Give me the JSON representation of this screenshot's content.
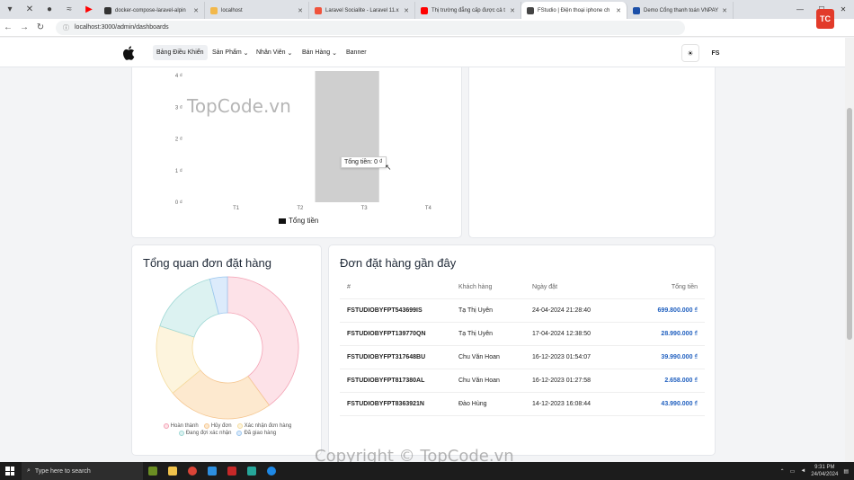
{
  "browser": {
    "tabs": [
      {
        "label": "docker-compose-laravel-alpin",
        "color": "#333333"
      },
      {
        "label": "localhost",
        "color": "#f2b84b"
      },
      {
        "label": "Laravel Socialite - Laravel 11.x",
        "color": "#f0533c"
      },
      {
        "label": "Thị trường đẳng cấp được cả t",
        "color": "#ff0000"
      },
      {
        "label": "FStudio | Điện thoại iphone ch",
        "color": "#444444",
        "active": true
      },
      {
        "label": "Demo Cổng thanh toán VNPAY",
        "color": "#1b4fa8"
      }
    ],
    "url": "localhost:3000/admin/dashboards"
  },
  "header": {
    "nav": [
      "Bảng Điều Khiển",
      "Sản Phẩm",
      "Nhân Viên",
      "Bán Hàng",
      "Banner"
    ],
    "avatar": "FS"
  },
  "revenue_chart": {
    "ylabels": [
      "4 ₫",
      "3 ₫",
      "2 ₫",
      "1 ₫",
      "0 ₫"
    ],
    "tooltip": "Tổng tiền: 0 ₫",
    "legend": "Tổng tiền"
  },
  "chart_data": [
    {
      "type": "bar",
      "categories": [
        "T1",
        "T2",
        "T3",
        "T4"
      ],
      "series": [
        {
          "name": "Tổng tiền",
          "values": [
            0,
            0,
            0,
            0
          ]
        }
      ],
      "ylim": [
        0,
        4
      ],
      "ylabel": "",
      "xlabel": ""
    },
    {
      "type": "pie",
      "title": "Tổng quan đơn đặt hàng",
      "categories": [
        "Hoàn thành",
        "Hủy đơn",
        "Xác nhận đơn hàng",
        "Đang đợi xác nhận",
        "Đã giao hàng"
      ],
      "values": [
        5,
        3,
        2,
        2,
        0.5
      ],
      "colors": [
        "#fde2e8",
        "#fde9cf",
        "#fdf4dd",
        "#dcf2f1",
        "#dcebfb"
      ],
      "strokes": [
        "#f3a3b5",
        "#f5c690",
        "#f5dc9e",
        "#9fd8d5",
        "#9cc7ef"
      ]
    }
  ],
  "orders_overview": {
    "title": "Tổng quan đơn đặt hàng"
  },
  "recent_orders": {
    "title": "Đơn đặt hàng gần đây",
    "columns": [
      "#",
      "Khách hàng",
      "Ngày đặt",
      "Tổng tiền"
    ],
    "rows": [
      [
        "FSTUDIOBYFPT543699IS",
        "Tạ Thị Uyên",
        "24-04-2024 21:28:40",
        "699.800.000 ₫"
      ],
      [
        "FSTUDIOBYFPT139770QN",
        "Tạ Thị Uyên",
        "17-04-2024 12:38:50",
        "28.990.000 ₫"
      ],
      [
        "FSTUDIOBYFPT317648BU",
        "Chu Văn Hoan",
        "16-12-2023 01:54:07",
        "39.990.000 ₫"
      ],
      [
        "FSTUDIOBYFPT817380AL",
        "Chu Văn Hoan",
        "16-12-2023 01:27:58",
        "2.658.000 ₫"
      ],
      [
        "FSTUDIOBYFPT8363921N",
        "Đào Hùng",
        "14-12-2023 16:08:44",
        "43.990.000 ₫"
      ]
    ]
  },
  "taskbar": {
    "search_placeholder": "Type here to search",
    "time": "9:31 PM",
    "date": "24/04/2024"
  },
  "watermark": {
    "text": "TopCode.vn",
    "copyright": "Copyright © TopCode.vn",
    "logo": "TOPCODE.VN"
  }
}
